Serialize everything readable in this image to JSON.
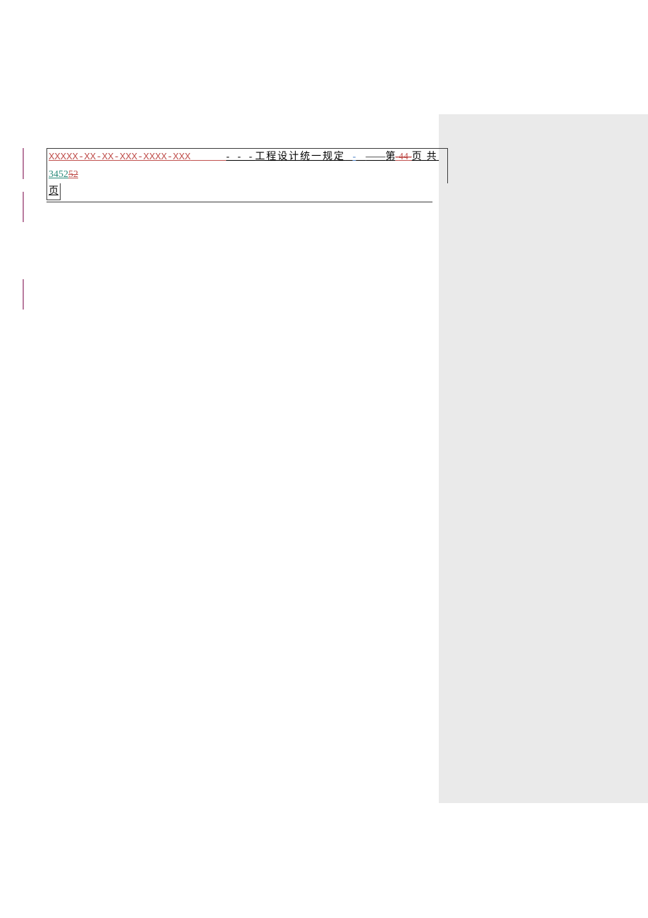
{
  "header": {
    "doc_code": "XXXXX-XX-XX-XXX-XXXX-XXX",
    "spacer1": "      ",
    "dashes1": "- - -",
    "title": "工程设计统一规定",
    "spacer2": "   ",
    "blue_dash": "-",
    "spacer3": "    ",
    "long_dash": "——",
    "page_prefix": "第",
    "page_del_dash": "-",
    "page_num_del": "44",
    "page_del_dash2": "-",
    "page_suffix1": "页",
    "spacer4": "  ",
    "total_label": "共",
    "spacer5": " ",
    "total_ins": "3452",
    "total_del": "52",
    "page_suffix2": "页"
  }
}
